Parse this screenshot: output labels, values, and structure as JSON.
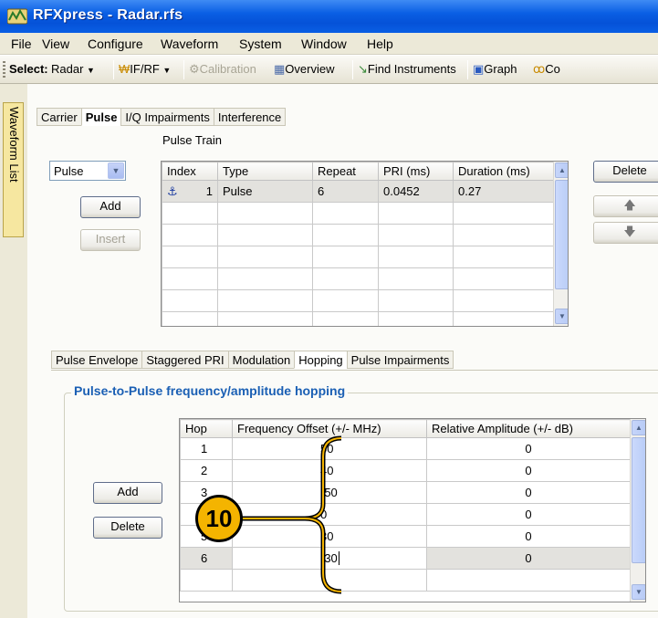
{
  "window": {
    "title": "RFXpress - Radar.rfs"
  },
  "menu": [
    "File",
    "View",
    "Configure",
    "Waveform",
    "System",
    "Window",
    "Help"
  ],
  "toolbar": {
    "select_label": "Select:",
    "select_value": "Radar",
    "ifrf": "IF/RF",
    "calibration": "Calibration",
    "overview": "Overview",
    "find_instruments": "Find Instruments",
    "graph": "Graph",
    "truncated": "Co"
  },
  "side_tab": "Waveform List",
  "top_tabs": [
    "Carrier",
    "Pulse",
    "I/Q Impairments",
    "Interference"
  ],
  "pulse_train": {
    "heading": "Pulse Train",
    "type_select": "Pulse",
    "add": "Add",
    "insert": "Insert",
    "delete": "Delete",
    "columns": [
      "Index",
      "Type",
      "Repeat",
      "PRI (ms)",
      "Duration (ms)"
    ],
    "rows": [
      {
        "index": "1",
        "type": "Pulse",
        "repeat": "6",
        "pri": "0.0452",
        "duration": "0.27"
      }
    ]
  },
  "sub_tabs": [
    "Pulse Envelope",
    "Staggered PRI",
    "Modulation",
    "Hopping",
    "Pulse Impairments"
  ],
  "hopping": {
    "group_title": "Pulse-to-Pulse frequency/amplitude hopping",
    "add": "Add",
    "delete": "Delete",
    "columns": [
      "Hop",
      "Frequency Offset (+/- MHz)",
      "Relative Amplitude (+/- dB)"
    ],
    "rows": [
      {
        "hop": "1",
        "freq": "50",
        "amp": "0"
      },
      {
        "hop": "2",
        "freq": "40",
        "amp": "0"
      },
      {
        "hop": "3",
        "freq": "-50",
        "amp": "0"
      },
      {
        "hop": "4",
        "freq": "0",
        "amp": "0"
      },
      {
        "hop": "5",
        "freq": "30",
        "amp": "0"
      },
      {
        "hop": "6",
        "freq": "-30",
        "amp": "0"
      }
    ]
  },
  "callout": "10",
  "colors": {
    "title_bar": "#0a5fe4",
    "callout_fill": "#f4b400",
    "group_title": "#1a5fb4"
  }
}
